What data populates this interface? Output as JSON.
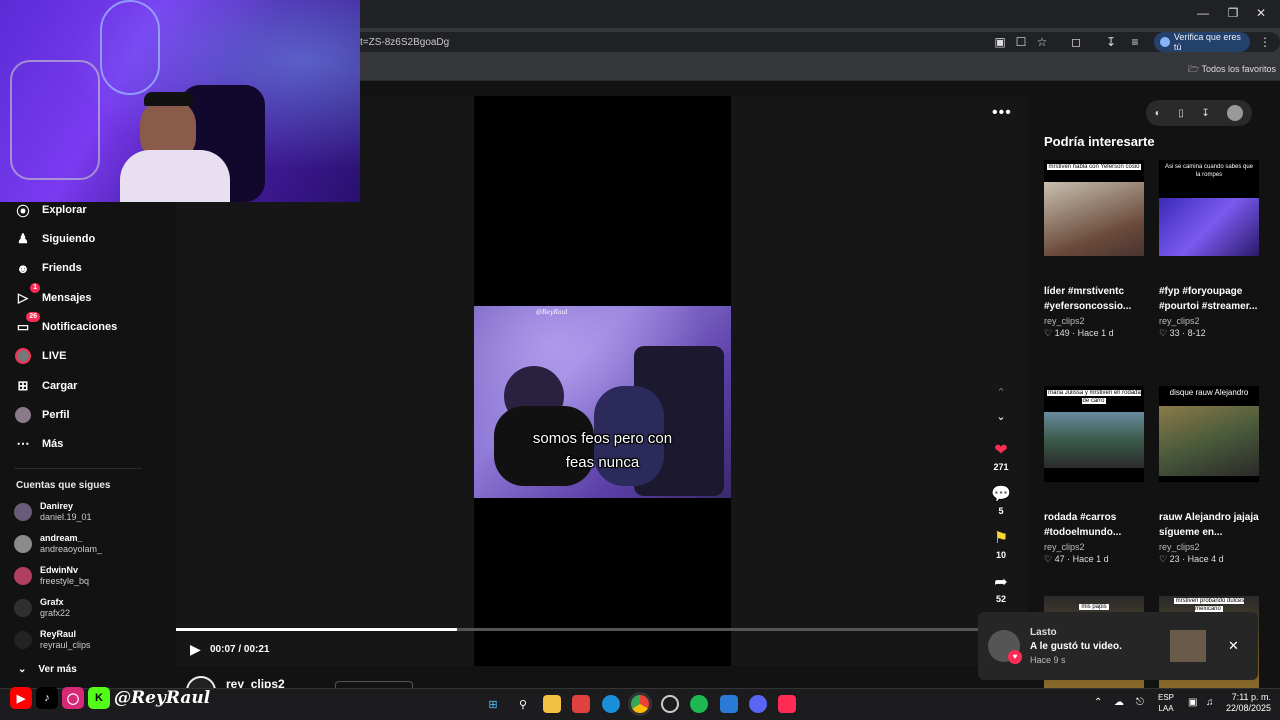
{
  "browser": {
    "url": "t=ZS-8z6S2BgoaDg",
    "verify_label": "Verifica que eres tú",
    "bookmarks_label": "Todos los favoritos"
  },
  "sidebar": {
    "items": [
      {
        "label": "Explorar",
        "icon": "compass-icon"
      },
      {
        "label": "Siguiendo",
        "icon": "following-icon"
      },
      {
        "label": "Friends",
        "icon": "friends-icon"
      },
      {
        "label": "Mensajes",
        "icon": "messages-icon",
        "badge": "1"
      },
      {
        "label": "Notificaciones",
        "icon": "notifications-icon",
        "badge": "26"
      },
      {
        "label": "LIVE",
        "icon": "live-icon"
      },
      {
        "label": "Cargar",
        "icon": "upload-icon"
      },
      {
        "label": "Perfil",
        "icon": "profile-icon"
      },
      {
        "label": "Más",
        "icon": "more-icon"
      }
    ],
    "following_title": "Cuentas que sigues",
    "accounts": [
      {
        "name": "Danirey",
        "handle": "daniel.19_01"
      },
      {
        "name": "andream_",
        "handle": "andreaoyolam_"
      },
      {
        "name": "EdwinNv",
        "handle": "freestyle_bq"
      },
      {
        "name": "Grafx",
        "handle": "grafx22"
      },
      {
        "name": "ReyRaul",
        "handle": "reyraul_clips"
      }
    ],
    "see_more": "Ver más"
  },
  "video": {
    "caption_line1": "somos feos pero con",
    "caption_line2": "feas nunca",
    "watermark": "@ReyRaul",
    "time": "00:07 / 00:21",
    "progress": 0.33,
    "author": "rey_clips2"
  },
  "actions": {
    "likes": "271",
    "comments": "5",
    "saves": "10",
    "shares": "52"
  },
  "suggestions": {
    "title": "Podría interesarte",
    "cards": [
      {
        "thumb_label": "mrstiven habla con Yeferson cosio",
        "desc_line1": "líder #mrstiventc",
        "desc_line2": "#yefersoncossio...",
        "user": "rey_clips2",
        "likes": "149",
        "age": "Hace 1 d"
      },
      {
        "thumb_label": "Asi se camina cuando sabes que la rompes",
        "desc_line1": "#fyp #foryoupage",
        "desc_line2": "#pourtoi #streamer...",
        "user": "rey_clips2",
        "likes": "33",
        "age": "8-12"
      },
      {
        "thumb_label": "maria Julissa y mrstiven en rodada de carro",
        "desc_line1": "rodada #carros",
        "desc_line2": "#todoelmundo...",
        "user": "rey_clips2",
        "likes": "47",
        "age": "Hace 1 d"
      },
      {
        "thumb_label": "disque rauw Alejandro",
        "desc_line1": "rauw Alejandro jajaja",
        "desc_line2": "sígueme en...",
        "user": "rey_clips2",
        "likes": "23",
        "age": "Hace 4 d"
      }
    ],
    "extra_labels": [
      "mis papis",
      "mrstiven probando dulces mexicano"
    ]
  },
  "notification": {
    "name": "Lasto",
    "message": "A le gustó tu video.",
    "time": "Hace 9 s"
  },
  "brand": {
    "name": "@ReyRaul",
    "colors": {
      "youtube": "#ff0000",
      "kick": "#53fc18",
      "instagram": "#d62976"
    }
  },
  "taskbar": {
    "lang1": "ESP",
    "lang2": "LAA",
    "time": "7:11 p. m.",
    "date": "22/08/2025"
  }
}
